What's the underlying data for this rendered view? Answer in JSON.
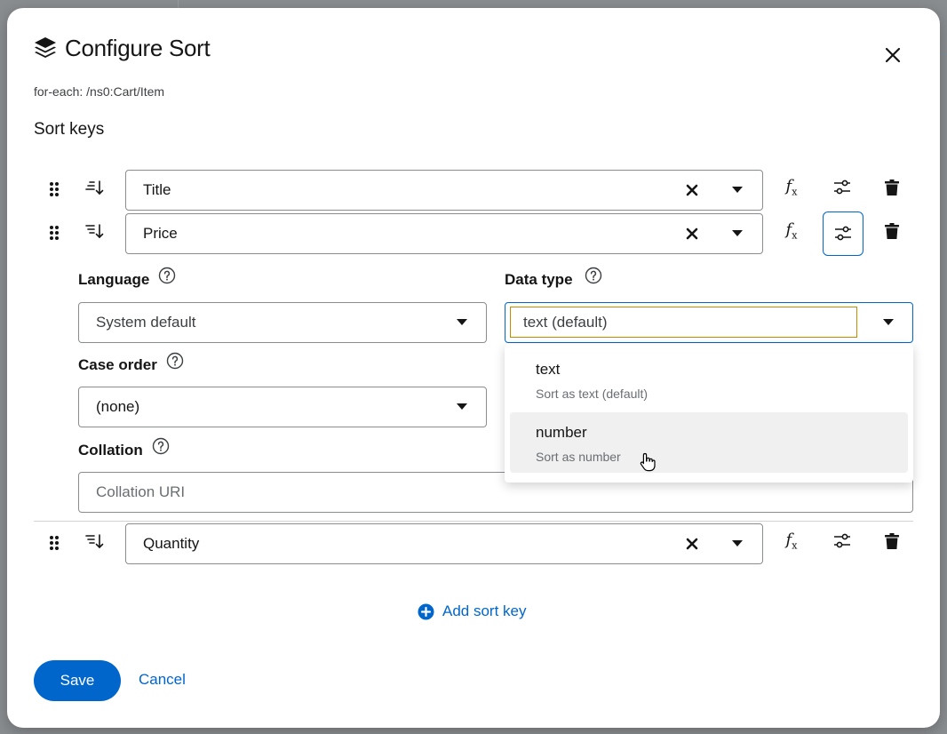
{
  "dialog": {
    "title": "Configure Sort",
    "subtitle": "for-each: /ns0:Cart/Item",
    "section_title": "Sort keys"
  },
  "sort_keys": [
    {
      "value": "Title"
    },
    {
      "value": "Price"
    },
    {
      "value": "Quantity"
    }
  ],
  "options_panel": {
    "language_label": "Language",
    "language_value": "System default",
    "data_type_label": "Data type",
    "data_type_value": "text (default)",
    "case_order_label": "Case order",
    "case_order_value": "(none)",
    "collation_label": "Collation",
    "collation_placeholder": "Collation URI"
  },
  "data_type_menu": [
    {
      "label": "text",
      "description": "Sort as text (default)"
    },
    {
      "label": "number",
      "description": "Sort as number"
    }
  ],
  "actions": {
    "add_label": "Add sort key",
    "save_label": "Save",
    "cancel_label": "Cancel"
  },
  "colors": {
    "primary": "#0066cc",
    "focus_highlight": "#c58c00",
    "overlay": "#8a8d90"
  }
}
